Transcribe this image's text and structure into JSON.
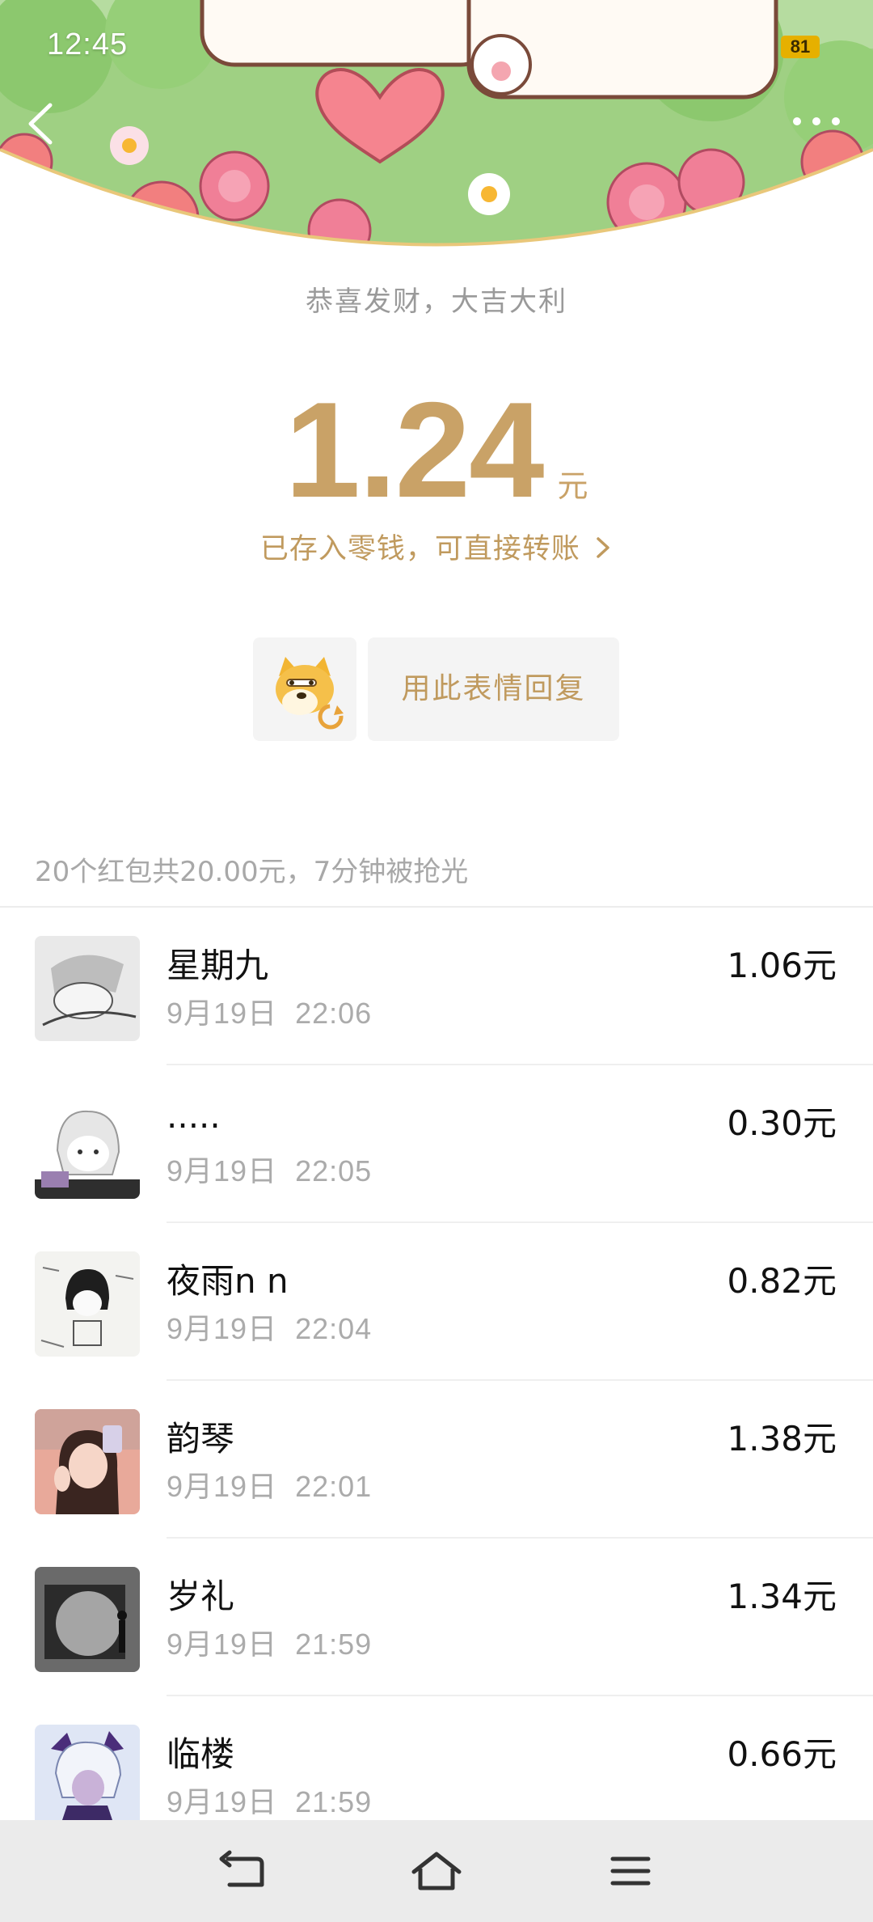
{
  "status_bar": {
    "time": "12:45",
    "battery": "81"
  },
  "header": {
    "greeting": "恭喜发财，大吉大利"
  },
  "amount": {
    "value": "1.24",
    "unit": "元",
    "saved_text": "已存入零钱，可直接转账"
  },
  "reply": {
    "button_label": "用此表情回复"
  },
  "summary": "20个红包共20.00元，7分钟被抢光",
  "claims": [
    {
      "name": "星期九",
      "time": "9月19日  22:06",
      "amount": "1.06元"
    },
    {
      "name": ".....",
      "time": "9月19日  22:05",
      "amount": "0.30元"
    },
    {
      "name": "夜雨n  n",
      "time": "9月19日  22:04",
      "amount": "0.82元"
    },
    {
      "name": "韵琴",
      "time": "9月19日  22:01",
      "amount": "1.38元"
    },
    {
      "name": "岁礼",
      "time": "9月19日  21:59",
      "amount": "1.34元"
    },
    {
      "name": "临楼",
      "time": "9月19日  21:59",
      "amount": "0.66元"
    }
  ]
}
